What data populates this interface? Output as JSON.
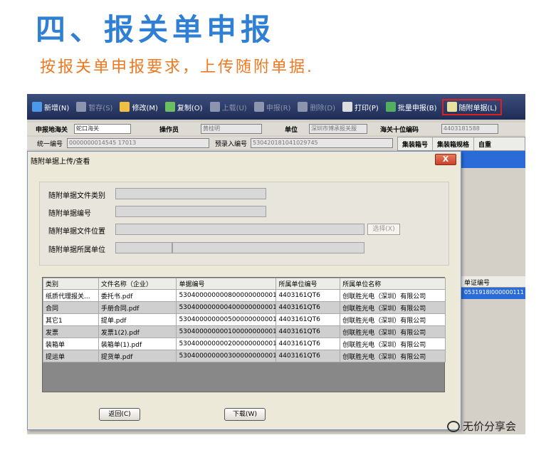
{
  "heading": {
    "title": "四、报关单申报",
    "subtitle": "按报关单申报要求，上传随附单据."
  },
  "toolbar": {
    "items": [
      {
        "label": "新增(N)",
        "icon": "new-icon",
        "color": "#4a9ae8",
        "disabled": false
      },
      {
        "label": "暂存(S)",
        "icon": "save-icon",
        "color": "#8c95ad",
        "disabled": true
      },
      {
        "label": "修改(M)",
        "icon": "edit-icon",
        "color": "#f0c040",
        "disabled": false
      },
      {
        "label": "复制(O)",
        "icon": "copy-icon",
        "color": "#6ac060",
        "disabled": false
      },
      {
        "label": "上载(U)",
        "icon": "upload-icon",
        "color": "#8c95ad",
        "disabled": true
      },
      {
        "label": "申报(R)",
        "icon": "declare-icon",
        "color": "#8c95ad",
        "disabled": true
      },
      {
        "label": "删除(D)",
        "icon": "delete-icon",
        "color": "#8c95ad",
        "disabled": true
      },
      {
        "label": "打印(P)",
        "icon": "print-icon",
        "color": "#dcdcdc",
        "disabled": false
      },
      {
        "label": "批量申报(B)",
        "icon": "batch-icon",
        "color": "#50b060",
        "disabled": false
      },
      {
        "label": "随附单据(L)",
        "icon": "attach-icon",
        "color": "#e8e0a0",
        "disabled": false
      }
    ]
  },
  "form": {
    "customs_label": "申报地海关",
    "customs_value": "蛇口海关",
    "operator_label": "操作员",
    "operator_value": "黄桂明",
    "unit_label": "单位",
    "unit_value": "深圳市博承报关服",
    "code_label": "海关十位编码",
    "code_value": "4403181588",
    "unified_label": "统一编号",
    "unified_value": "0000000014545 17013",
    "pre_label": "预录入编号",
    "pre_value": "530420181041029745"
  },
  "rightgrid": {
    "col1": "集装箱号",
    "col2": "集装箱规格",
    "col3": "自重",
    "cert_header": "单证编号",
    "cert_value": "0531918I000000111"
  },
  "dialog": {
    "title": "随附单据上传/查看",
    "close": "X",
    "field1": "随附单据文件类别",
    "field2": "随附单据编号",
    "field3": "随附单据文件位置",
    "field4": "随附单据所属单位",
    "select_btn": "选择(X)",
    "back_btn": "返回(C)",
    "download_btn": "下载(W)"
  },
  "grid": {
    "headers": [
      "类别",
      "文件名称（企业）",
      "单据编号",
      "所属单位编号",
      "所属单位名称"
    ],
    "rows": [
      [
        "纸质代理报关...",
        "委托书.pdf",
        "530400000000800000000001859...",
        "4403161QT6",
        "创联胜光电（深圳）有限公司"
      ],
      [
        "合同",
        "手册合同.pdf",
        "530400000000400000000001859...",
        "4403161QT6",
        "创联胜光电（深圳）有限公司"
      ],
      [
        "其它1",
        "提单.pdf",
        "530400000000500000000001859...",
        "4403161QT6",
        "创联胜光电（深圳）有限公司"
      ],
      [
        "发票",
        "发票1(2).pdf",
        "530400000000100000000001859...",
        "4403161QT6",
        "创联胜光电（深圳）有限公司"
      ],
      [
        "装箱单",
        "装箱单(1).pdf",
        "530400000000200000000001859...",
        "4403161QT6",
        "创联胜光电（深圳）有限公司"
      ],
      [
        "提运单",
        "提货单.pdf",
        "530400000000300000000001859...",
        "4403161QT6",
        "创联胜光电（深圳）有限公司"
      ]
    ]
  },
  "watermark": {
    "text": "无价分享会"
  }
}
